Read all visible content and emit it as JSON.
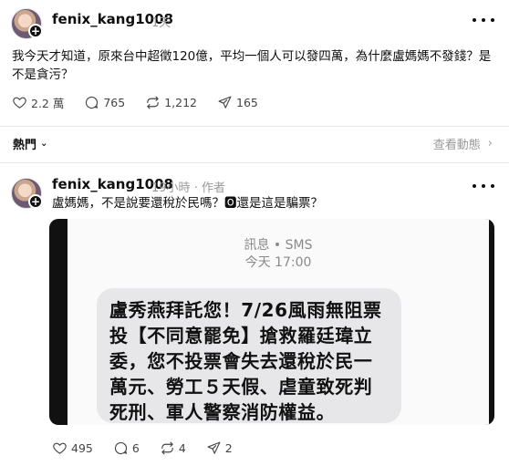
{
  "post1": {
    "username": "fenix_kang1008",
    "time": "1天",
    "text": "我今天才知道，原來台中超徵120億，平均一個人可以發四萬，為什麼盧媽媽不發錢？是不是貪污？",
    "likes": "2.2 萬",
    "replies": "765",
    "reposts": "1,212",
    "shares": "165"
  },
  "hot_bar": {
    "label": "熱門",
    "activity": "查看動態"
  },
  "post2": {
    "username": "fenix_kang1008",
    "time": "19小時",
    "author_tag": "作者",
    "text": "盧媽媽，不是說要還稅於民嗎？🅾還是這是騙票？",
    "likes": "495",
    "replies": "6",
    "reposts": "4",
    "shares": "2",
    "sms": {
      "sender": "訊息 • SMS",
      "time": "今天 17:00",
      "message": "盧秀燕拜託您！7/26風雨無阻票投【不同意罷免】搶救羅廷瑋立委，您不投票會失去還稅於民一萬元、勞工５天假、虐童致死判死刑、軍人警察消防權益。"
    }
  },
  "icons": {
    "like": "heart-icon",
    "reply": "comment-icon",
    "repost": "repost-icon",
    "share": "send-icon",
    "more": "more-icon"
  }
}
